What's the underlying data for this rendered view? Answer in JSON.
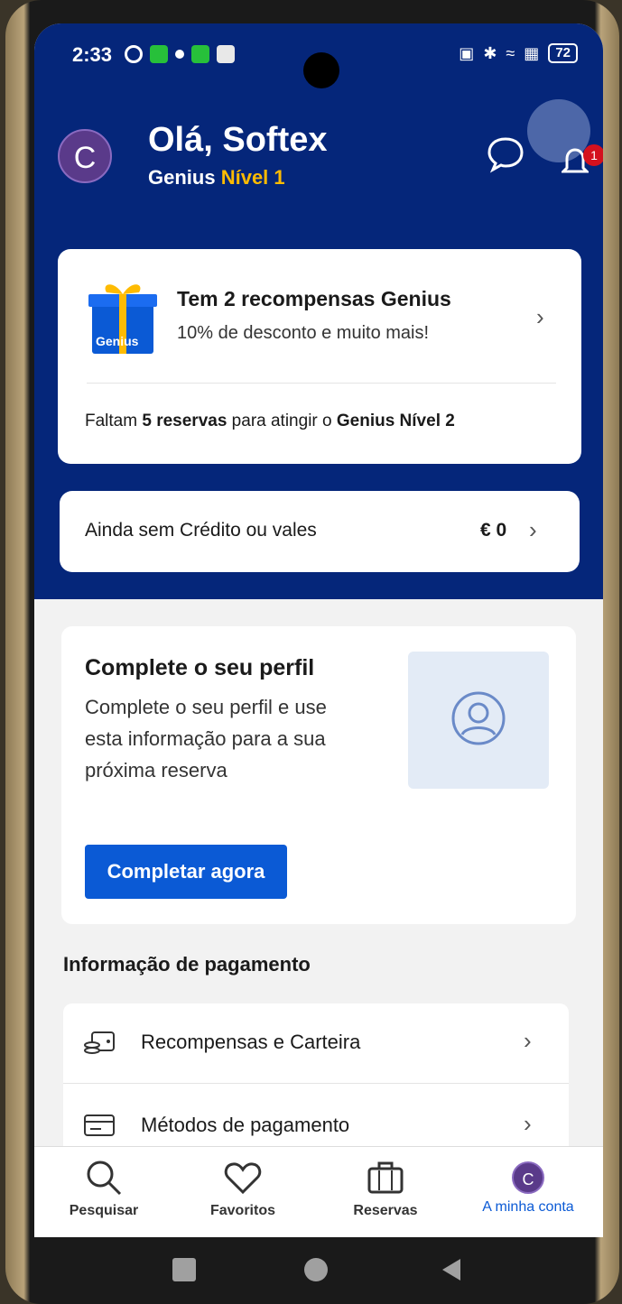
{
  "status_bar": {
    "time": "2:33",
    "battery": "72"
  },
  "header": {
    "avatar_initial": "C",
    "greeting": "Olá, Softex",
    "genius_prefix": "Genius",
    "genius_level": "Nível 1",
    "notification_count": "1"
  },
  "rewards_card": {
    "title": "Tem 2 recompensas Genius",
    "subtitle": "10% de desconto e muito mais!",
    "gift_label": "Genius",
    "footer_prefix": "Faltam ",
    "footer_bold1": "5 reservas",
    "footer_middle": " para atingir o ",
    "footer_bold2": "Genius Nível 2"
  },
  "credit_card": {
    "label": "Ainda sem Crédito ou vales",
    "value": "€ 0"
  },
  "profile_card": {
    "title": "Complete o seu perfil",
    "description": "Complete o seu perfil e use esta informação para a sua próxima reserva",
    "button": "Completar agora"
  },
  "payment_section": {
    "title": "Informação de pagamento",
    "items": [
      {
        "label": "Recompensas e Carteira",
        "icon": "wallet-icon"
      },
      {
        "label": "Métodos de pagamento",
        "icon": "card-icon"
      }
    ]
  },
  "bottom_nav": {
    "items": [
      {
        "label": "Pesquisar",
        "icon": "search-icon"
      },
      {
        "label": "Favoritos",
        "icon": "heart-icon"
      },
      {
        "label": "Reservas",
        "icon": "briefcase-icon"
      },
      {
        "label": "A minha conta",
        "icon": "avatar"
      }
    ],
    "avatar_initial": "C"
  },
  "colors": {
    "brand_blue": "#05267a",
    "accent_blue": "#0b5ad5",
    "genius_yellow": "#febb02"
  }
}
